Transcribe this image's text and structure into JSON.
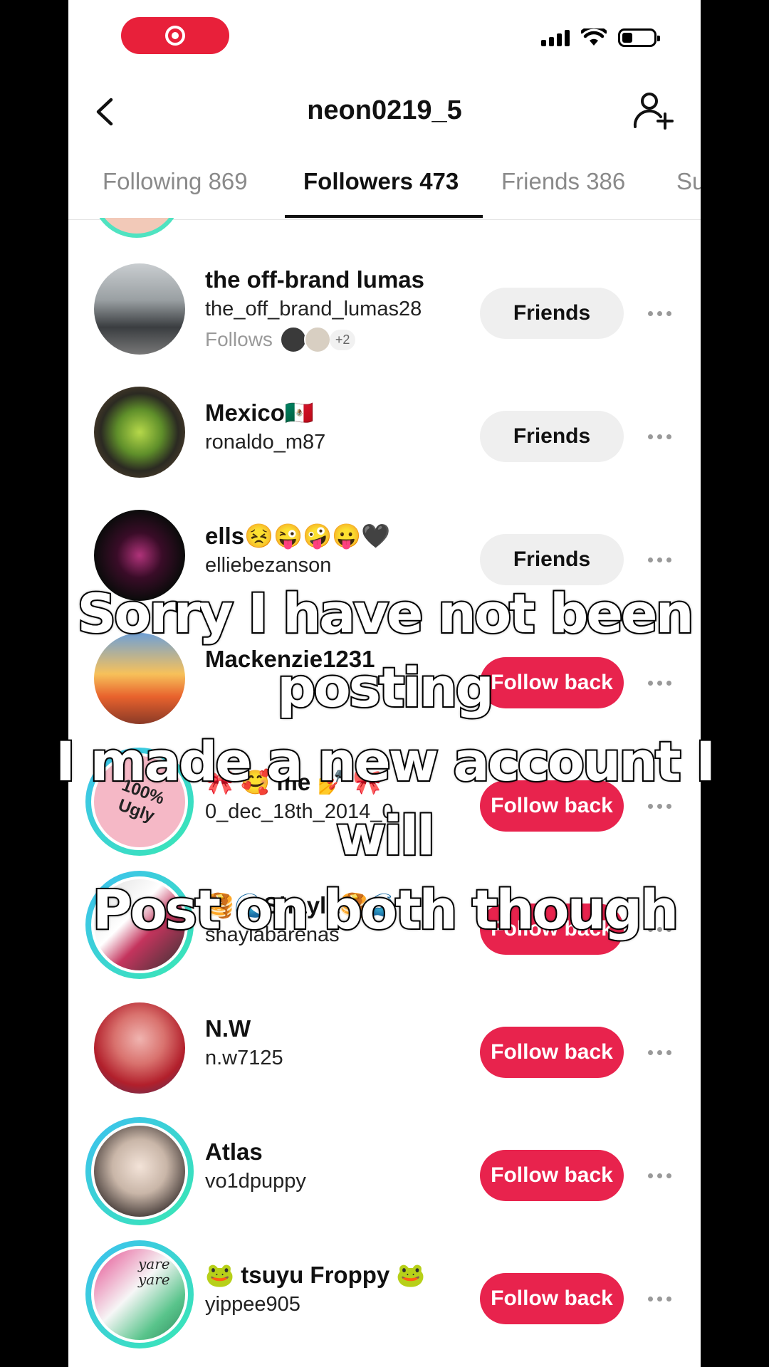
{
  "header": {
    "title": "neon0219_5"
  },
  "tabs": [
    {
      "label": "Following 869"
    },
    {
      "label": "Followers 473"
    },
    {
      "label": "Friends 386"
    },
    {
      "label": "Su"
    }
  ],
  "followers": [
    {
      "name": "the off-brand lumas",
      "handle": "the_off_brand_lumas28",
      "follows_label": "Follows",
      "follows_more": "+2",
      "button": "Friends"
    },
    {
      "name": "Mexico🇲🇽",
      "handle": "ronaldo_m87",
      "button": "Friends"
    },
    {
      "name": "ells😣😜🤪😛🖤",
      "handle": "elliebezanson",
      "button": "Friends"
    },
    {
      "name": "Mackenzie1231",
      "handle": "",
      "button": "Follow back"
    },
    {
      "name": "🎀 🥰 me 💅 🎀",
      "handle": "0_dec_18th_2014_0",
      "button": "Follow back",
      "avatar_text": "100% Ugly"
    },
    {
      "name": "🥞🌊Shayla🥞🌊",
      "handle": "shaylabarenas",
      "button": "Follow back"
    },
    {
      "name": "N.W",
      "handle": "n.w7125",
      "button": "Follow back"
    },
    {
      "name": "Atlas",
      "handle": "vo1dpuppy",
      "button": "Follow back"
    },
    {
      "name": "🐸 tsuyu Froppy 🐸",
      "handle": "yippee905",
      "button": "Follow back",
      "avatar_text": "yare yare"
    }
  ],
  "caption": {
    "line1": "Sorry I have not been posting",
    "line2": "I made a new account I will",
    "line3": "Post on both though"
  },
  "colors": {
    "follow_back": "#e8234d",
    "friends_bg": "#efefef",
    "ring_start": "#3cc0f0",
    "ring_end": "#3ae8b3"
  }
}
